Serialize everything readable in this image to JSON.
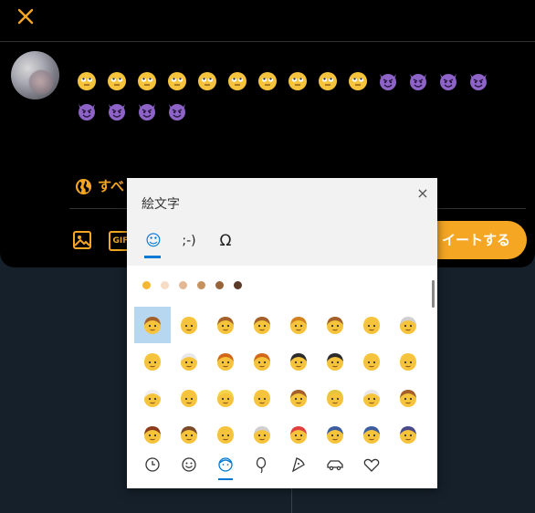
{
  "compose": {
    "close_icon": "close-icon",
    "audience_label": "すべ",
    "tweet_button": "イートする",
    "gif_label": "GIF",
    "text_emojis": [
      "face",
      "face",
      "face",
      "face",
      "face",
      "face",
      "face",
      "face",
      "face",
      "face",
      "devil",
      "devil",
      "devil",
      "devil",
      "devil",
      "devil",
      "devil",
      "devil"
    ],
    "accent": "#f5a623"
  },
  "picker": {
    "title": "絵文字",
    "close": "×",
    "tabs": [
      {
        "label": "☺",
        "name": "tab-emoji"
      },
      {
        "label": ";-)",
        "name": "tab-kaomoji"
      },
      {
        "label": "Ω",
        "name": "tab-symbols"
      }
    ],
    "skin_tones": [
      "#f5b731",
      "#f7dcc6",
      "#e4b894",
      "#c6935f",
      "#97643a",
      "#5b3a29"
    ],
    "categories": [
      "clock-icon",
      "smiley-icon",
      "people-icon",
      "balloon-icon",
      "pizza-icon",
      "car-icon",
      "heart-icon"
    ],
    "selected_category": 2
  }
}
